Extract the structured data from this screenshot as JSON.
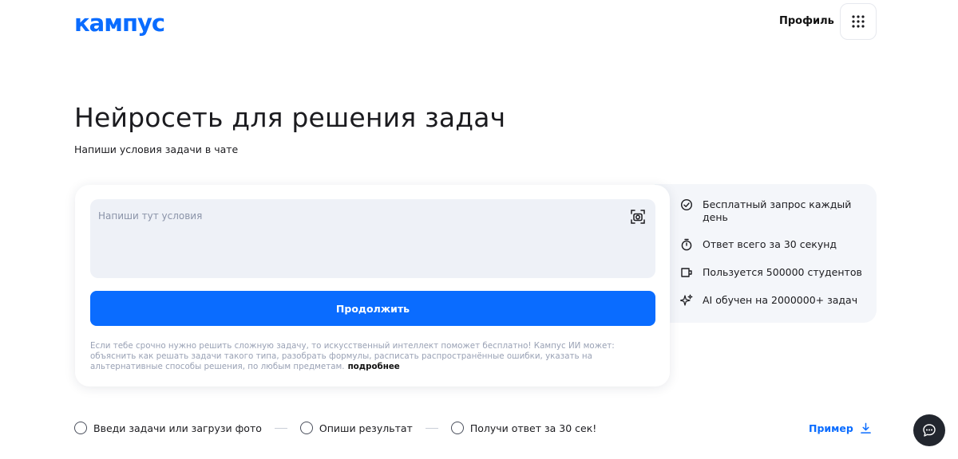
{
  "header": {
    "logo": "кампус",
    "profile_label": "Профиль",
    "apps_icon": "grid-icon"
  },
  "hero": {
    "title": "Нейросеть для решения задач",
    "subtitle": "Напиши условия задачи в чате"
  },
  "form": {
    "placeholder": "Напиши тут условия",
    "camera_icon": "camera-scan-icon",
    "continue_label": "Продолжить",
    "description": "Если тебе срочно нужно решить сложную задачу, то искусственный интеллект поможет бесплатно! Кампус ИИ может: объяснить как решать задачи такого типа, разобрать формулы, расписать распространённые ошибки, указать на альтернативные способы решения, по любым предметам.",
    "more_link": "подробнее"
  },
  "features": [
    {
      "icon": "check-circle-icon",
      "label": "Бесплатный запрос каждый день"
    },
    {
      "icon": "stopwatch-icon",
      "label": "Ответ всего за 30 секунд"
    },
    {
      "icon": "mug-icon",
      "label": "Пользуется 500000 студентов"
    },
    {
      "icon": "sparkles-icon",
      "label": "AI обучен на 2000000+ задач"
    }
  ],
  "steps": [
    {
      "label": "Введи задачи или загрузи фото"
    },
    {
      "label": "Опиши результат"
    },
    {
      "label": "Получи ответ за 30 сек!"
    }
  ],
  "example": {
    "label": "Пример",
    "icon": "download-icon"
  },
  "chat": {
    "icon": "chat-bubble-icon"
  },
  "colors": {
    "accent": "#0a6cff",
    "panel_bg": "#f4f6fa",
    "input_bg": "#eef1f7",
    "chat_bg": "#22262e"
  }
}
